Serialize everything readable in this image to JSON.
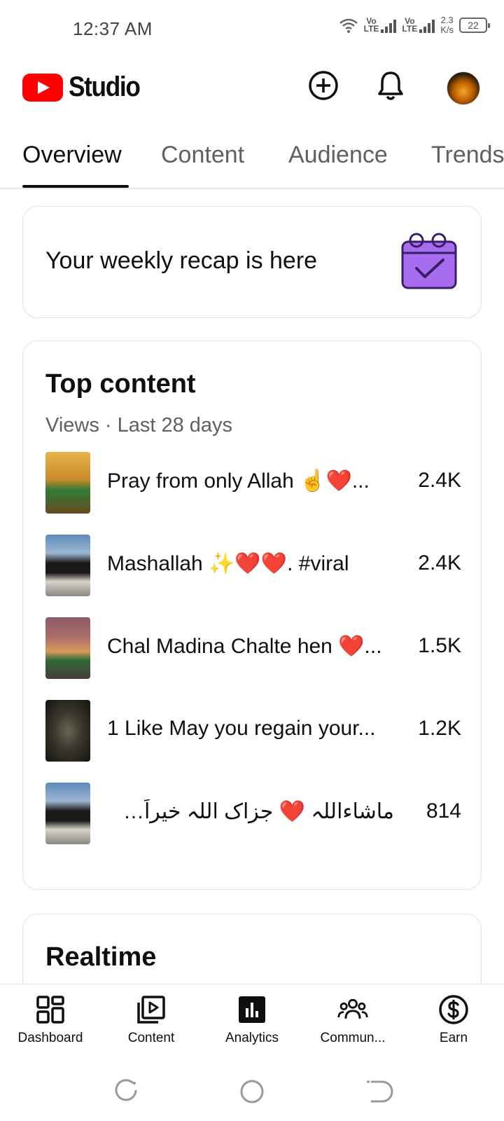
{
  "status_bar": {
    "time": "12:37 AM",
    "network_label_1": "Vo\nLTE",
    "network_label_2": "Vo\nLTE",
    "speed": "2.3\nK/s",
    "battery": "22"
  },
  "header": {
    "logo_text": "Studio",
    "icons": [
      "add-circle-icon",
      "bell-icon",
      "avatar"
    ]
  },
  "tabs": [
    {
      "label": "Overview",
      "active": true
    },
    {
      "label": "Content",
      "active": false
    },
    {
      "label": "Audience",
      "active": false
    },
    {
      "label": "Trends",
      "active": false
    }
  ],
  "recap": {
    "text": "Your weekly recap is here",
    "icon": "calendar-check-icon",
    "icon_color": "#a86cf0"
  },
  "top_content": {
    "title": "Top content",
    "subtitle": "Views · Last 28 days",
    "items": [
      {
        "title": "Pray from only Allah ☝️❤️...",
        "views": "2.4K"
      },
      {
        "title": "Mashallah ✨❤️❤️. #viral",
        "views": "2.4K"
      },
      {
        "title": "Chal Madina Chalte hen ❤️...",
        "views": "1.5K"
      },
      {
        "title": "1 Like May you regain your...",
        "views": "1.2K"
      },
      {
        "title": "ماشاءاللہ ❤️ جزاک اللہ خیراً✨ #...",
        "views": "814"
      }
    ]
  },
  "realtime": {
    "title": "Realtime"
  },
  "bottom_nav": [
    {
      "label": "Dashboard",
      "icon": "dashboard-icon"
    },
    {
      "label": "Content",
      "icon": "content-icon"
    },
    {
      "label": "Analytics",
      "icon": "analytics-icon",
      "active": true
    },
    {
      "label": "Commun...",
      "icon": "community-icon"
    },
    {
      "label": "Earn",
      "icon": "earn-icon"
    }
  ],
  "colors": {
    "brand_red": "#ff0000",
    "text_primary": "#0f0f0f",
    "text_secondary": "#606060"
  }
}
